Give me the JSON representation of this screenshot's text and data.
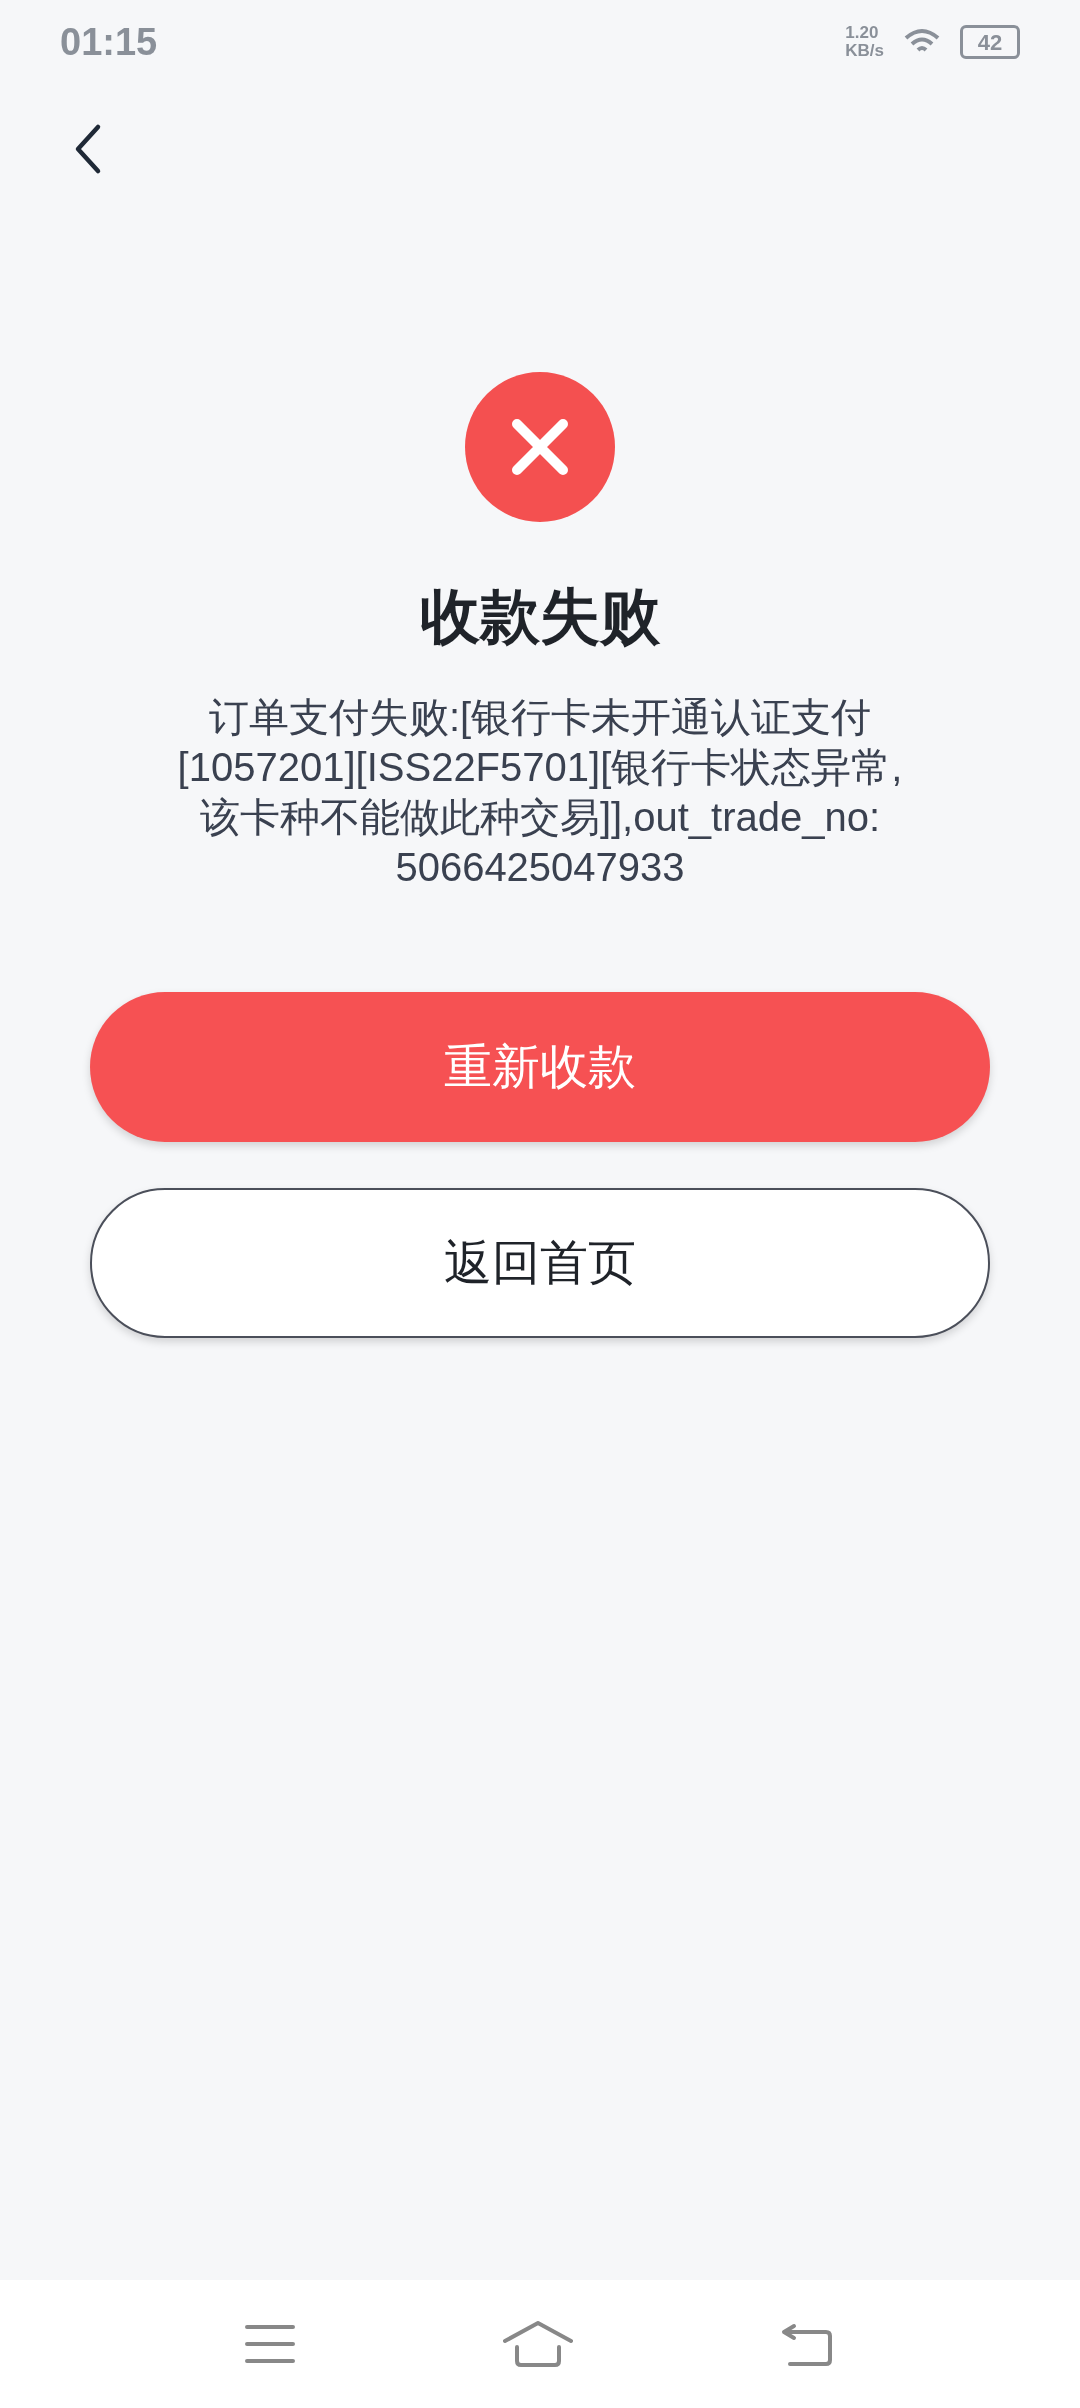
{
  "status_bar": {
    "time": "01:15",
    "network_speed": [
      "1.20",
      "KB/s"
    ],
    "battery": "42"
  },
  "result": {
    "title": "收款失败",
    "message_lines": [
      "订单支付失败:[银行卡未开通认证支付",
      "[1057201][ISS22F5701][银行卡状态异常,",
      "该卡种不能做此种交易]],out_trade_no:",
      "5066425047933"
    ]
  },
  "buttons": [
    {
      "label": "重新收款",
      "kind": "primary"
    },
    {
      "label": "返回首页",
      "kind": "secondary"
    }
  ]
}
